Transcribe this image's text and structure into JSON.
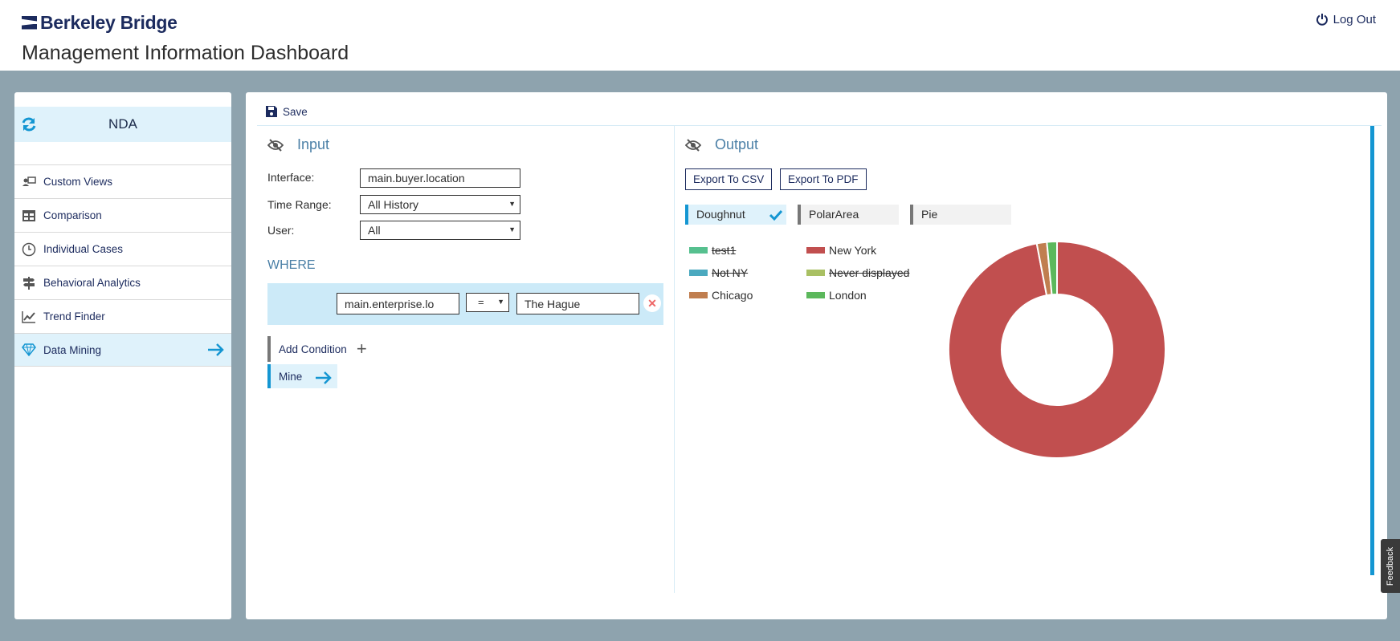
{
  "brand": {
    "name": "Berkeley Bridge"
  },
  "header": {
    "title": "Management Information Dashboard",
    "logout_label": "Log Out"
  },
  "sidebar": {
    "title": "NDA",
    "items": [
      {
        "label": "Custom Views",
        "icon": "custom-views-icon"
      },
      {
        "label": "Comparison",
        "icon": "table-icon"
      },
      {
        "label": "Individual Cases",
        "icon": "clock-icon"
      },
      {
        "label": "Behavioral Analytics",
        "icon": "signpost-icon"
      },
      {
        "label": "Trend Finder",
        "icon": "trend-icon"
      },
      {
        "label": "Data Mining",
        "icon": "diamond-icon",
        "active": true
      }
    ]
  },
  "toolbar": {
    "save_label": "Save"
  },
  "input": {
    "title": "Input",
    "interface_label": "Interface:",
    "interface_value": "main.buyer.location",
    "time_range_label": "Time Range:",
    "time_range_value": "All History",
    "user_label": "User:",
    "user_value": "All",
    "where_title": "WHERE",
    "condition": {
      "field": "main.enterprise.lo",
      "operator": "=",
      "value": "The Hague"
    },
    "add_condition_label": "Add Condition",
    "mine_label": "Mine"
  },
  "output": {
    "title": "Output",
    "export_csv_label": "Export To CSV",
    "export_pdf_label": "Export To PDF",
    "chart_tabs": [
      {
        "label": "Doughnut",
        "selected": true
      },
      {
        "label": "PolarArea",
        "selected": false
      },
      {
        "label": "Pie",
        "selected": false
      }
    ]
  },
  "chart_data": {
    "type": "pie",
    "variant": "doughnut",
    "legend": [
      {
        "label": "test1",
        "color": "#56c08f",
        "hidden": true
      },
      {
        "label": "New York",
        "color": "#c14f4f",
        "hidden": false
      },
      {
        "label": "Not NY",
        "color": "#4ba9bf",
        "hidden": true
      },
      {
        "label": "Never displayed",
        "color": "#a9c063",
        "hidden": true
      },
      {
        "label": "Chicago",
        "color": "#c07e4f",
        "hidden": false
      },
      {
        "label": "London",
        "color": "#5cb85c",
        "hidden": false
      }
    ],
    "slices": [
      {
        "label": "New York",
        "value": 97,
        "color": "#c14f4f"
      },
      {
        "label": "Chicago",
        "value": 1.5,
        "color": "#c07e4f"
      },
      {
        "label": "London",
        "value": 1.5,
        "color": "#5cb85c"
      }
    ]
  },
  "feedback_label": "Feedback"
}
